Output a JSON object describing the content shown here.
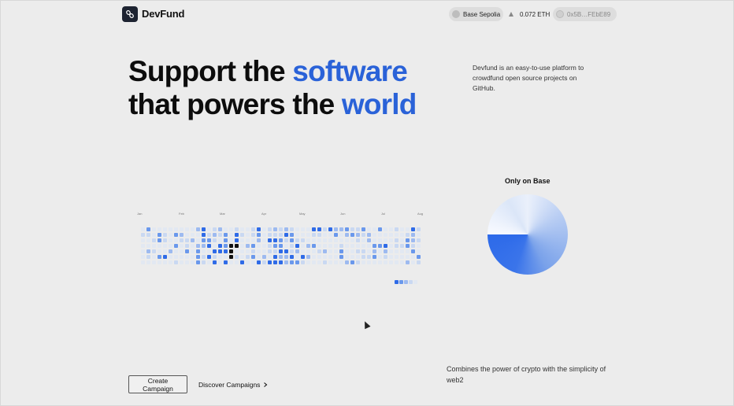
{
  "brand": {
    "name": "DevFund",
    "logo_icon": "link-icon"
  },
  "header": {
    "network_label": "Base Sepolia",
    "balance": "0.072 ETH",
    "address": "0x5B…FEbE89"
  },
  "hero": {
    "line1_plain": "Support the",
    "line1_accent": "software",
    "line2_plain": "that powers the",
    "line2_accent": "world",
    "accent_color": "#2a62d8"
  },
  "intro": "Devfund is an easy-to-use platform to crowdfund open source projects on GitHub.",
  "activity": {
    "months": [
      "Jan",
      "Feb",
      "Mar",
      "Apr",
      "May",
      "Jun",
      "Jul",
      "Aug"
    ],
    "levels": [
      "#e2e8f2",
      "#c9d8f2",
      "#9dbaf0",
      "#6a98ec",
      "#2f6be7"
    ],
    "highlight_color": "#111111"
  },
  "pie": {
    "title": "Only on Base"
  },
  "actions": {
    "create_label": "Create Campaign",
    "discover_label": "Discover Campaigns"
  },
  "tagline": "Combines the power of crypto with the simplicity of web2"
}
